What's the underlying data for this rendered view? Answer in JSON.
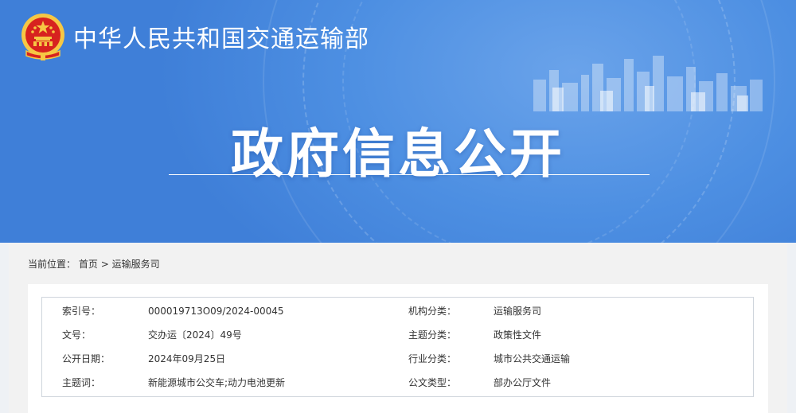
{
  "header": {
    "site_name": "中华人民共和国交通运输部",
    "hero_title": "政府信息公开"
  },
  "breadcrumb": {
    "prefix": "当前位置：",
    "home": "首页",
    "separator": ">",
    "current": "运输服务司"
  },
  "info": {
    "rows": [
      {
        "left_label": "索引号：",
        "left_value": "000019713O09/2024-00045",
        "right_label": "机构分类：",
        "right_value": "运输服务司"
      },
      {
        "left_label": "文号：",
        "left_value": "交办运〔2024〕49号",
        "right_label": "主题分类：",
        "right_value": "政策性文件"
      },
      {
        "left_label": "公开日期：",
        "left_value": "2024年09月25日",
        "right_label": "行业分类：",
        "right_value": "城市公共交通运输"
      },
      {
        "left_label": "主题词：",
        "left_value": "新能源城市公交车;动力电池更新",
        "right_label": "公文类型：",
        "right_value": "部办公厅文件"
      }
    ]
  },
  "colors": {
    "banner_blue": "#4d8fe2",
    "emblem_red": "#d7221f",
    "emblem_gold": "#f6c744"
  },
  "icons": {
    "emblem": "national-emblem-icon",
    "skyline": "city-skyline-graphic"
  }
}
